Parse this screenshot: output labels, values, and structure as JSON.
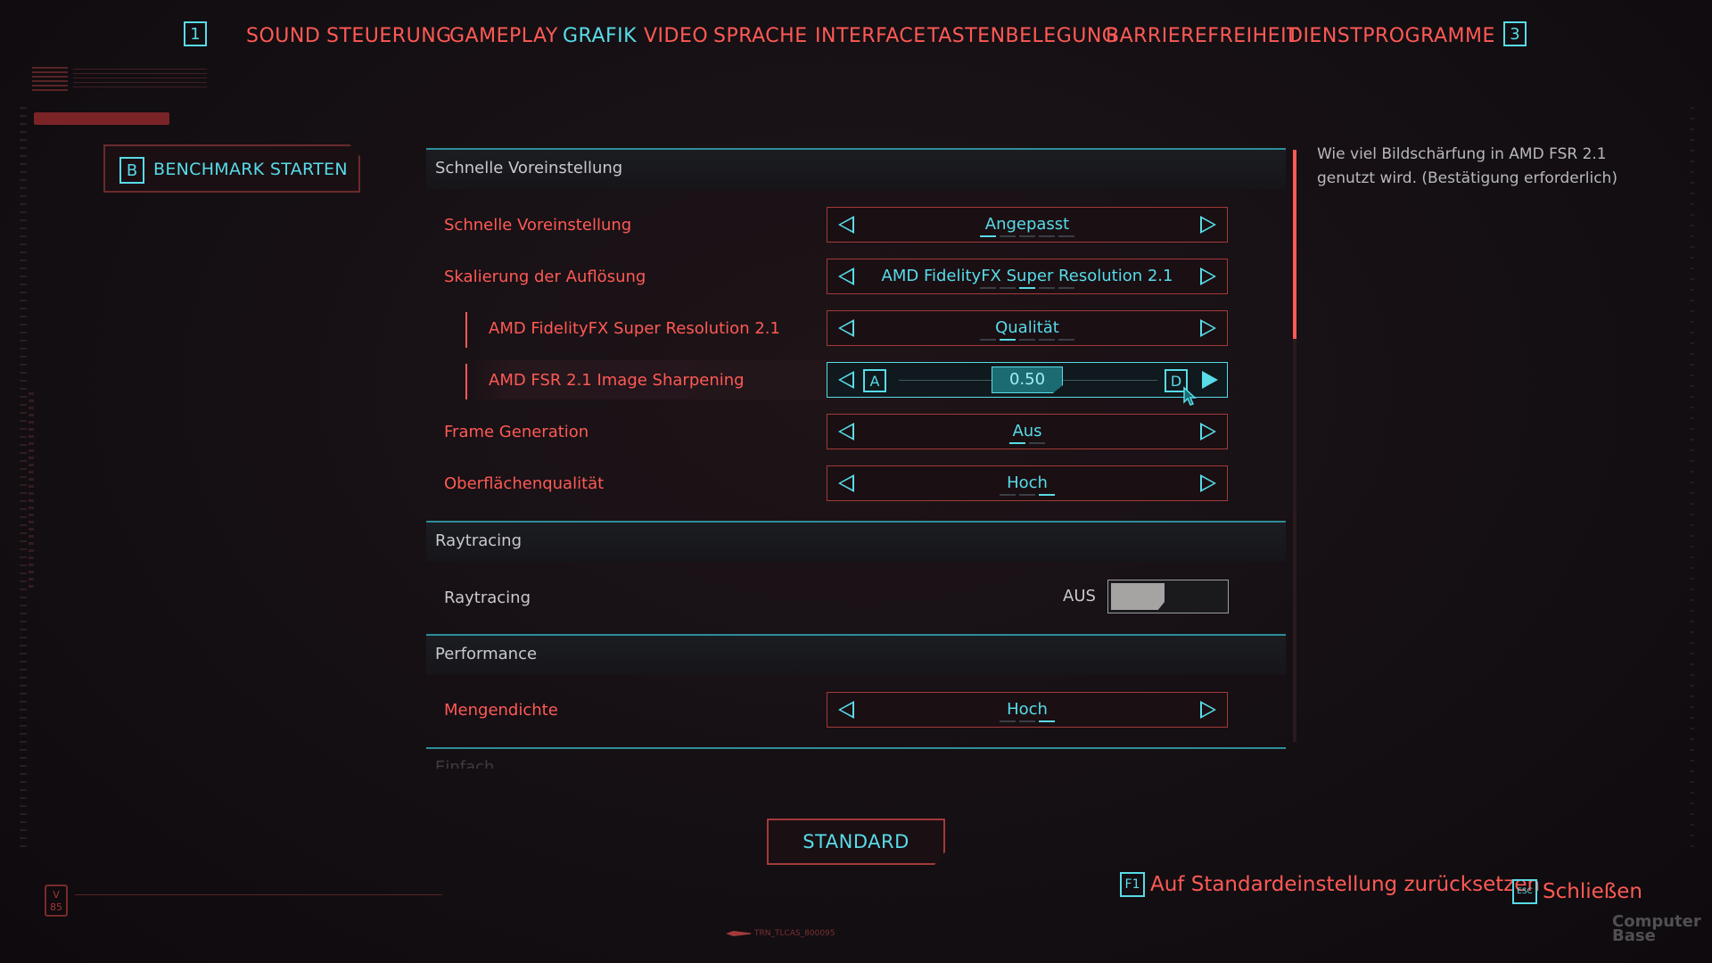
{
  "nav": {
    "left_key": "1",
    "right_key": "3",
    "tabs": [
      {
        "label": "SOUND",
        "active": false
      },
      {
        "label": "STEUERUNG",
        "active": false
      },
      {
        "label": "GAMEPLAY",
        "active": false
      },
      {
        "label": "GRAFIK",
        "active": true
      },
      {
        "label": "VIDEO",
        "active": false
      },
      {
        "label": "SPRACHE",
        "active": false
      },
      {
        "label": "INTERFACE",
        "active": false
      },
      {
        "label": "TASTENBELEGUNG",
        "active": false
      },
      {
        "label": "BARRIEREFREIHEIT",
        "active": false
      },
      {
        "label": "DIENSTPROGRAMME",
        "active": false
      }
    ]
  },
  "benchmark": {
    "key": "B",
    "label": "BENCHMARK STARTEN"
  },
  "sections": {
    "quick": {
      "title": "Schnelle Voreinstellung",
      "rows": {
        "preset": {
          "label": "Schnelle Voreinstellung",
          "value": "Angepasst"
        },
        "scaling": {
          "label": "Skalierung der Auflösung",
          "value": "AMD FidelityFX Super Resolution 2.1"
        },
        "fsr": {
          "label": "AMD FidelityFX Super Resolution 2.1",
          "value": "Qualität"
        },
        "sharpening": {
          "label": "AMD FSR 2.1 Image Sharpening",
          "value": "0.50",
          "key_left": "A",
          "key_right": "D",
          "level": 0.5
        },
        "framegen": {
          "label": "Frame Generation",
          "value": "Aus"
        },
        "texture": {
          "label": "Oberflächenqualität",
          "value": "Hoch"
        }
      }
    },
    "raytracing": {
      "title": "Raytracing",
      "rows": {
        "rt": {
          "label": "Raytracing",
          "state": "AUS"
        }
      }
    },
    "performance": {
      "title": "Performance",
      "rows": {
        "crowd": {
          "label": "Mengendichte",
          "value": "Hoch"
        }
      },
      "next_section_peek": "Einfach"
    }
  },
  "description": "Wie viel Bildschärfung in AMD FSR 2.1 genutzt wird. (Bestätigung erforderlich)",
  "standard_button": "STANDARD",
  "footer": {
    "reset_key": "F1",
    "reset_label": "Auf Standardeinstellung zurücksetzen",
    "close_key": "ESC",
    "close_label": "Schließen",
    "version_badge": "V 85",
    "footer_code": "TRN_TLCAS_800095",
    "watermark": "Computer Base"
  },
  "colors": {
    "accent_cyan": "#57dce8",
    "accent_red": "#ff5a55",
    "background": "#140f13"
  }
}
